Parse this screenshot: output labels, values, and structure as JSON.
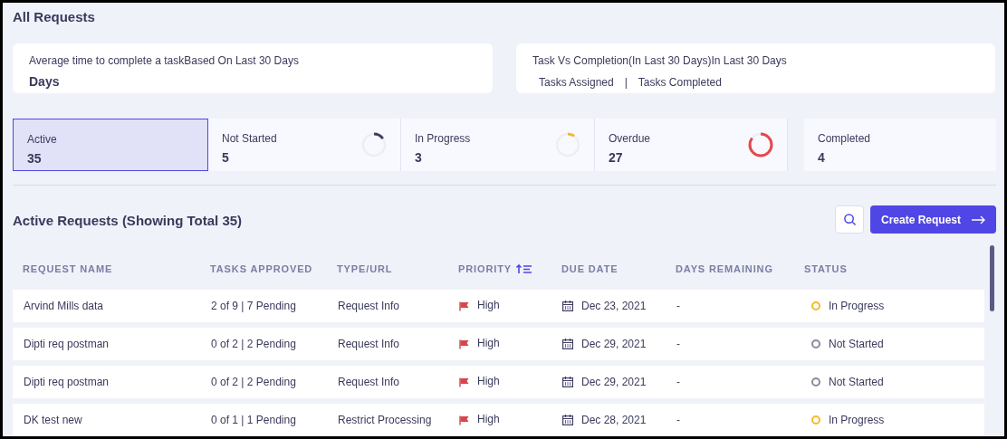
{
  "page_title": "All Requests",
  "summary_cards": [
    {
      "title": "Average time to complete a taskBased On Last 30 Days",
      "value": "Days"
    },
    {
      "title": "Task Vs Completion(In Last 30 Days)In Last 30 Days",
      "legend": [
        "Tasks Assigned",
        "|",
        "Tasks Completed"
      ]
    }
  ],
  "stat_cards": [
    {
      "label": "Active",
      "count": "35",
      "selected": true
    },
    {
      "label": "Not Started",
      "count": "5",
      "selected": false,
      "color": "#3f3d64"
    },
    {
      "label": "In Progress",
      "count": "3",
      "selected": false,
      "color": "#f5b82e"
    },
    {
      "label": "Overdue",
      "count": "27",
      "selected": false,
      "color": "#e5484d"
    },
    {
      "label": "Completed",
      "count": "4",
      "selected": false
    }
  ],
  "section_title": "Active Requests (Showing Total 35)",
  "create_button": "Create Request",
  "table": {
    "columns": [
      "REQUEST NAME",
      "TASKS APPROVED",
      "TYPE/URL",
      "PRIORITY",
      "DUE DATE",
      "DAYS REMAINING",
      "STATUS"
    ],
    "rows": [
      {
        "name": "Arvind Mills data",
        "tasks": "2 of 9 | 7 Pending",
        "type": "Request Info",
        "priority": "High",
        "due": "Dec 23, 2021",
        "days": "-",
        "status": "In Progress",
        "color": "#f5b82e"
      },
      {
        "name": "Dipti req postman",
        "tasks": "0 of 2 | 2 Pending",
        "type": "Request Info",
        "priority": "High",
        "due": "Dec 29, 2021",
        "days": "-",
        "status": "Not Started",
        "color": "#8a8a99"
      },
      {
        "name": "Dipti req postman",
        "tasks": "0 of 2 | 2 Pending",
        "type": "Request Info",
        "priority": "High",
        "due": "Dec 29, 2021",
        "days": "-",
        "status": "Not Started",
        "color": "#8a8a99"
      },
      {
        "name": "DK test new",
        "tasks": "0 of 1 | 1 Pending",
        "type": "Restrict Processing",
        "priority": "High",
        "due": "Dec 28, 2021",
        "days": "-",
        "status": "In Progress",
        "color": "#f5b82e"
      }
    ]
  }
}
